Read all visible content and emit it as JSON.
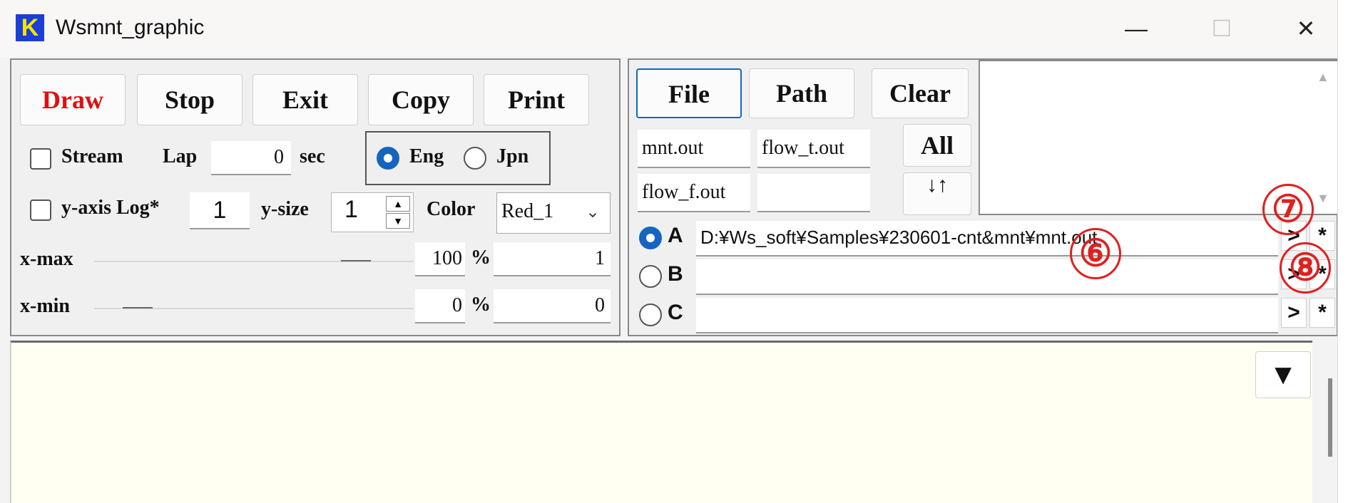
{
  "window": {
    "title": "Wsmnt_graphic",
    "logo_letter": "K",
    "controls": {
      "minimize": "—",
      "maximize": "☐",
      "close": "✕"
    }
  },
  "toolbar": {
    "draw": "Draw",
    "stop": "Stop",
    "exit": "Exit",
    "copy": "Copy",
    "print": "Print"
  },
  "options": {
    "stream_label": "Stream",
    "lap_label": "Lap",
    "lap_value": "0",
    "lap_unit": "sec",
    "lang_eng": "Eng",
    "lang_jpn": "Jpn",
    "ylog_label": "y-axis Log*",
    "ylog_value": "1",
    "ysize_label": "y-size",
    "ysize_value": "1",
    "color_label": "Color",
    "color_value": "Red_1"
  },
  "range": {
    "xmax_label": "x-max",
    "xmax_percent": "100",
    "xmax_value": "1",
    "xmin_label": "x-min",
    "xmin_percent": "0",
    "xmin_value": "0",
    "percent_sign": "%"
  },
  "files": {
    "file_btn": "File",
    "path_btn": "Path",
    "clear_btn": "Clear",
    "all_btn": "All",
    "sort_btn": "↓↑",
    "slot1": "mnt.out",
    "slot2": "flow_t.out",
    "slot3": "flow_f.out",
    "slot4": ""
  },
  "sources": [
    {
      "label": "A",
      "path": "D:¥Ws_soft¥Samples¥230601-cnt&mnt¥mnt.out",
      "selected": true
    },
    {
      "label": "B",
      "path": "",
      "selected": false
    },
    {
      "label": "C",
      "path": "",
      "selected": false
    }
  ],
  "row_buttons": {
    "next": ">",
    "star": "*"
  },
  "annotations": {
    "a6": "⑥",
    "a7": "⑦",
    "a8": "⑧"
  },
  "canvas": {
    "toggle": "▼"
  },
  "colors": {
    "draw_text": "#e01010",
    "accent": "#1565c0",
    "annotation": "#e02020",
    "canvas_bg": "#fffff2"
  }
}
